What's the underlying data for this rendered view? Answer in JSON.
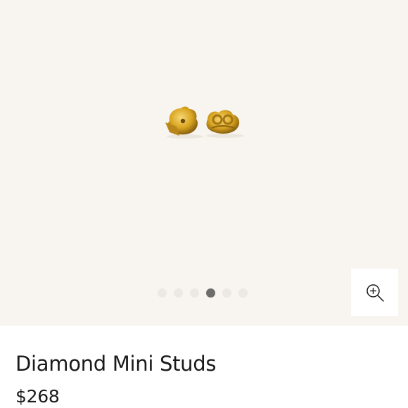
{
  "gallery": {
    "slide_count": 6,
    "active_index": 3,
    "background_color": "#f8f5f1",
    "image_alt": "Gold earring backs",
    "zoom_icon": "zoom-in-icon"
  },
  "product": {
    "title": "Diamond Mini Studs",
    "price": "$268"
  },
  "colors": {
    "gold": "#d9a520",
    "dot_active": "#6f6d6b",
    "dot_inactive": "#ece8e3",
    "text": "#1a1a1a"
  }
}
